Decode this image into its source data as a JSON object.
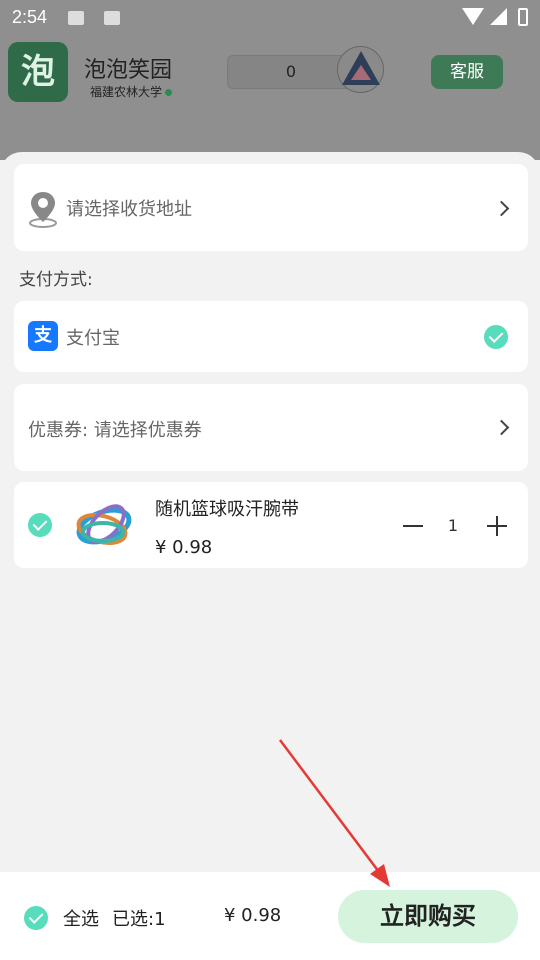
{
  "status_bar": {
    "time": "2:54"
  },
  "header": {
    "logo_char": "泡",
    "app_name": "泡泡笑园",
    "school": "福建农林大学",
    "counter_value": "0",
    "service_label": "客服"
  },
  "address": {
    "placeholder": "请选择收货地址"
  },
  "payment": {
    "section_title": "支付方式:",
    "method_icon_char": "支",
    "method_label": "支付宝",
    "selected": true
  },
  "coupon": {
    "label": "优惠券:  请选择优惠券"
  },
  "cart_items": [
    {
      "name": "随机篮球吸汗腕带",
      "price": "¥ 0.98",
      "quantity": "1",
      "checked": true
    }
  ],
  "bottom_bar": {
    "select_all": "全选",
    "selected_count": "已选:1",
    "total": "¥ 0.98",
    "buy_label": "立即购买"
  },
  "colors": {
    "accent_check": "#57dcbc",
    "buy_button_bg": "#d6f3dd",
    "alipay_blue": "#1677ff",
    "annotation_arrow": "#e53935"
  }
}
